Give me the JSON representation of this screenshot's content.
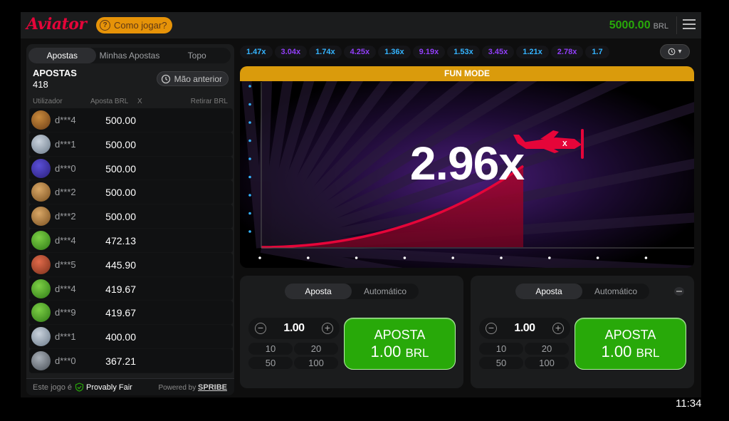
{
  "header": {
    "logo": "Aviator",
    "how_to_play": "Como jogar?",
    "balance": "5000.00",
    "currency": "BRL"
  },
  "bets_panel": {
    "tabs": [
      "Apostas",
      "Minhas Apostas",
      "Topo"
    ],
    "title": "APOSTAS",
    "count": "418",
    "prev_button": "Mão anterior",
    "columns": {
      "user": "Utilizador",
      "bet": "Aposta BRL",
      "x": "X",
      "cashout": "Retirar BRL"
    },
    "rows": [
      {
        "user": "d***4",
        "bet": "500.00",
        "avatar": "tiger"
      },
      {
        "user": "d***1",
        "bet": "500.00",
        "avatar": "silver"
      },
      {
        "user": "d***0",
        "bet": "500.00",
        "avatar": "purple"
      },
      {
        "user": "d***2",
        "bet": "500.00",
        "avatar": "lion"
      },
      {
        "user": "d***2",
        "bet": "500.00",
        "avatar": "lion"
      },
      {
        "user": "d***4",
        "bet": "472.13",
        "avatar": "clover"
      },
      {
        "user": "d***5",
        "bet": "445.90",
        "avatar": "crab"
      },
      {
        "user": "d***4",
        "bet": "419.67",
        "avatar": "clover"
      },
      {
        "user": "d***9",
        "bet": "419.67",
        "avatar": "clover"
      },
      {
        "user": "d***1",
        "bet": "400.00",
        "avatar": "silver"
      },
      {
        "user": "d***0",
        "bet": "367.21",
        "avatar": "grey"
      }
    ],
    "footer": {
      "prefix": "Este jogo é",
      "provably": "Provably Fair",
      "powered": "Powered by",
      "brand": "SPRIBE"
    }
  },
  "history": [
    {
      "value": "1.47x",
      "color": "#34b4ff"
    },
    {
      "value": "3.04x",
      "color": "#913ef8"
    },
    {
      "value": "1.74x",
      "color": "#34b4ff"
    },
    {
      "value": "4.25x",
      "color": "#913ef8"
    },
    {
      "value": "1.36x",
      "color": "#34b4ff"
    },
    {
      "value": "9.19x",
      "color": "#913ef8"
    },
    {
      "value": "1.53x",
      "color": "#34b4ff"
    },
    {
      "value": "3.45x",
      "color": "#913ef8"
    },
    {
      "value": "1.21x",
      "color": "#34b4ff"
    },
    {
      "value": "2.78x",
      "color": "#913ef8"
    },
    {
      "value": "1.7",
      "color": "#34b4ff"
    }
  ],
  "game": {
    "mode_label": "FUN MODE",
    "multiplier": "2.96x",
    "accent": "#e50539"
  },
  "controls": [
    {
      "tabs": [
        "Aposta",
        "Automático"
      ],
      "amount": "1.00",
      "quick": [
        "10",
        "20",
        "50",
        "100"
      ],
      "button_line1": "APOSTA",
      "button_amount": "1.00",
      "button_currency": "BRL"
    },
    {
      "tabs": [
        "Aposta",
        "Automático"
      ],
      "amount": "1.00",
      "quick": [
        "10",
        "20",
        "50",
        "100"
      ],
      "button_line1": "APOSTA",
      "button_amount": "1.00",
      "button_currency": "BRL"
    }
  ],
  "clock": "11:34"
}
